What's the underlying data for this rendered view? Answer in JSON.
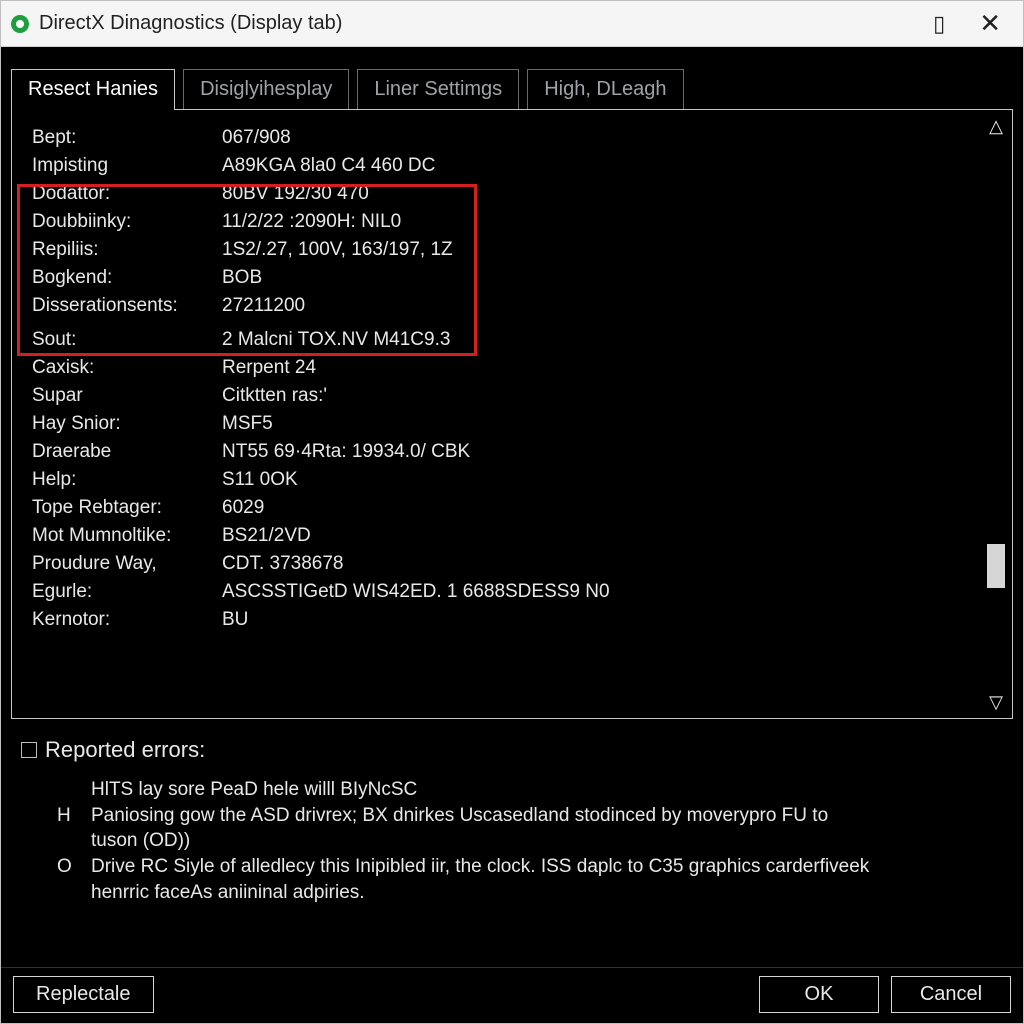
{
  "window": {
    "title": "DirectX Dinagnostics (Display tab)"
  },
  "tabs": [
    {
      "label": "Resect Hanies",
      "active": true
    },
    {
      "label": "Disiglyihesplay",
      "active": false
    },
    {
      "label": "Liner Settimgs",
      "active": false
    },
    {
      "label": "High, DLeagh",
      "active": false
    }
  ],
  "info_rows": [
    {
      "k": "Bept:",
      "v": "067/908"
    },
    {
      "k": "Impisting",
      "v": "A89KGA 8la0 C4 460 DC"
    },
    {
      "k": "Dodattor:",
      "v": "80BV 192/30 470"
    },
    {
      "k": "Doubbiinky:",
      "v": "11/2/22 :2090H: NIL0"
    },
    {
      "k": "Repiliis:",
      "v": "1S2/.27, 100V, 163/197, 1Z"
    },
    {
      "k": "Bogkend:",
      "v": "BOB"
    },
    {
      "k": "Disserationsents:",
      "v": "27211200"
    },
    {
      "k": "",
      "v": ""
    },
    {
      "k": "Sout:",
      "v": "2 Malcni TOX.NV M41C9.3"
    },
    {
      "k": "Caxisk:",
      "v": "Rerpent 24"
    },
    {
      "k": "Supar",
      "v": "Citktten ras:'"
    },
    {
      "k": "Hay Snior:",
      "v": "MSF5"
    },
    {
      "k": "Draerabe",
      "v": "NT55 69·4Rta: 19934.0/ CBK"
    },
    {
      "k": "Help:",
      "v": "S11 0OK"
    },
    {
      "k": "Tope Rebtager:",
      "v": "6029"
    },
    {
      "k": "Mot Mumnoltike:",
      "v": "BS21/2VD"
    },
    {
      "k": "Proudure Way,",
      "v": "CDT. 3738678"
    },
    {
      "k": "Egurle:",
      "v": "ASCSSTIGetD WIS42ED. 1 6688SDESS9 N0"
    },
    {
      "k": "Kernotor:",
      "v": "BU"
    }
  ],
  "highlight": {
    "colors": {
      "border": "#d21f1f"
    }
  },
  "errors": {
    "heading": "Reported errors:",
    "lines": [
      {
        "bullet": "",
        "text": "HlTS lay sore PeaD hele willl BIyNcSC"
      },
      {
        "bullet": "H",
        "text": "Paniosing gow the ASD drivrex; BX dnirkes Uscasedland stodinced by moverypro FU to"
      },
      {
        "bullet": "",
        "text": "tuson (OD))"
      },
      {
        "bullet": "O",
        "text": "Drive RC Siyle of alledlecy this Inipibled iir, the clock. ISS daplc to C35 graphics carderfiveek"
      },
      {
        "bullet": "",
        "text": "henrric faceAs aniininal adpiries."
      }
    ]
  },
  "buttons": {
    "replectale": "Replectale",
    "ok": "OK",
    "cancel": "Cancel"
  }
}
